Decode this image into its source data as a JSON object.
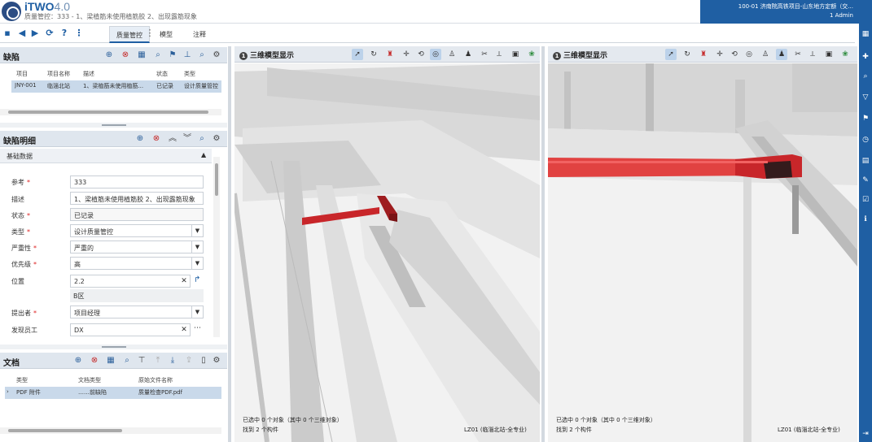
{
  "header": {
    "brand": "iTWO",
    "brand_version": "4.0",
    "subtitle": "质量管控：333 - 1、梁植筋未使用植筋胶 2、出现露筋现象",
    "project_line": "100-01 济南院高铁项目-山东地方定额（交...",
    "user": "1 Admin"
  },
  "toolbar": {
    "icons": [
      "save-icon",
      "prev-icon",
      "next-icon",
      "refresh-icon",
      "help-icon",
      "more-icon"
    ],
    "tabs": [
      {
        "label": "质量管控",
        "active": true
      },
      {
        "label": "模型",
        "active": false
      },
      {
        "label": "注释",
        "active": false
      }
    ]
  },
  "defects_panel": {
    "title": "缺陷",
    "columns": [
      "项目",
      "项目名称",
      "描述",
      "状态",
      "类型"
    ],
    "rows": [
      {
        "project": "JNY-001",
        "project_name": "临淄北站",
        "description": "1、梁植筋未使用植筋...",
        "status": "已记录",
        "type": "设计质量管控"
      }
    ]
  },
  "defect_detail": {
    "title": "缺陷明细",
    "section": "基础数据",
    "fields": {
      "ref_label": "参考",
      "ref_value": "333",
      "desc_label": "描述",
      "desc_value": "1、梁植筋未使用植筋胶 2、出现露筋现象",
      "status_label": "状态",
      "status_value": "已记录",
      "type_label": "类型",
      "type_value": "设计质量管控",
      "severity_label": "严重性",
      "severity_value": "严重的",
      "priority_label": "优先级",
      "priority_value": "高",
      "location_label": "位置",
      "location_value": "2.2",
      "location_sub": "B区",
      "reporter_label": "提出者",
      "reporter_value": "项目经理",
      "finder_label": "发现员工",
      "finder_value": "DX"
    }
  },
  "docs_panel": {
    "title": "文档",
    "columns": [
      "类型",
      "文档类型",
      "原始文件名称"
    ],
    "rows": [
      {
        "type": "PDF 附件",
        "doc_type": "……前缺陷",
        "filename": "质量检查PDF.pdf"
      }
    ]
  },
  "viewport_left": {
    "num": "1",
    "title": "三维模型显示",
    "status_line1": "已选中 0 个对象（其中 0 个三维对象）",
    "status_line2": "找到 2 个构件",
    "model_label": "LZ01 (临淄北站-全专业)"
  },
  "viewport_right": {
    "num": "1",
    "title": "三维模型显示",
    "status_line1": "已选中 0 个对象（其中 0 个三维对象）",
    "status_line2": "找到 2 个构件",
    "model_label": "LZ01 (临淄北站-全专业)"
  },
  "colors": {
    "brand": "#1f5fa3",
    "highlight": "#e0302f"
  }
}
